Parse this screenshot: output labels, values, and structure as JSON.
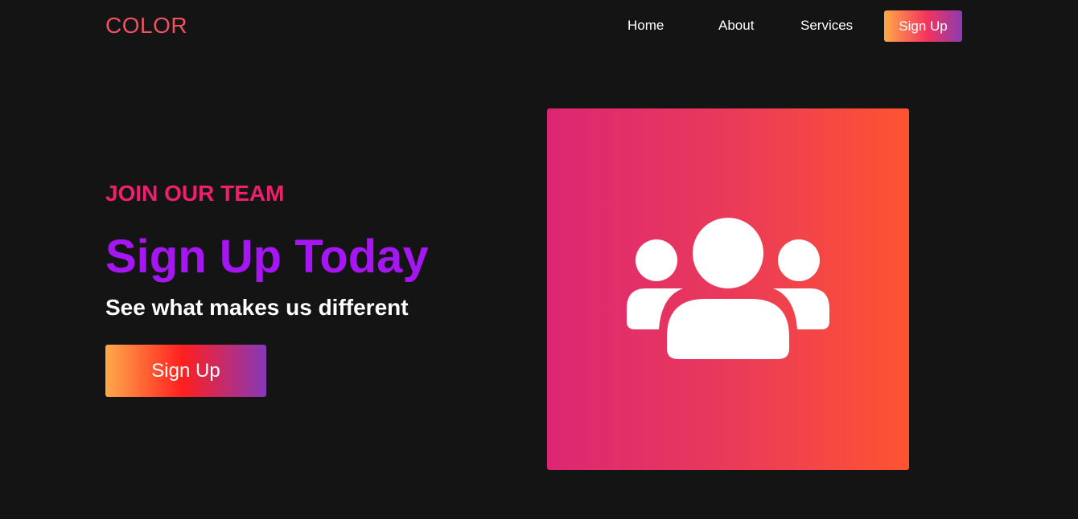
{
  "nav": {
    "logo": "COLOR",
    "links": [
      {
        "label": "Home"
      },
      {
        "label": "About"
      },
      {
        "label": "Services"
      }
    ],
    "signup_label": "Sign Up"
  },
  "hero": {
    "eyebrow": "JOIN OUR TEAM",
    "title": "Sign Up Today",
    "subtitle": "See what makes us different",
    "button_label": "Sign Up"
  },
  "illustration": {
    "icon": "users-group-icon"
  },
  "colors": {
    "background": "#141414",
    "logo": "#f0505f",
    "eyebrow": "#ee1f6b",
    "title": "#a516f2",
    "text": "#ffffff",
    "button_gradient": [
      "#ffaa4a",
      "#ff1f1f",
      "#8638b8"
    ],
    "panel_gradient": [
      "#dd2673",
      "#ff5330"
    ]
  }
}
